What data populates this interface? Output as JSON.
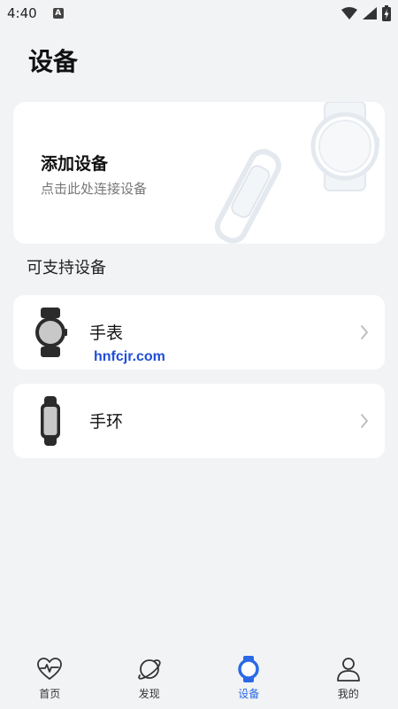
{
  "status_bar": {
    "time": "4:40",
    "notification_icon": "A",
    "icons": [
      "wifi-icon",
      "signal-icon",
      "battery-charging-icon"
    ]
  },
  "page": {
    "title": "设备"
  },
  "add_device_card": {
    "title": "添加设备",
    "subtitle": "点击此处连接设备"
  },
  "supported_section": {
    "title": "可支持设备",
    "items": [
      {
        "label": "手表",
        "icon": "watch-icon"
      },
      {
        "label": "手环",
        "icon": "band-icon"
      }
    ]
  },
  "watermark": "hnfcjr.com",
  "bottom_nav": {
    "active_index": 2,
    "active_color": "#2a6ae8",
    "items": [
      {
        "label": "首页",
        "icon": "heart-pulse-icon"
      },
      {
        "label": "发现",
        "icon": "planet-icon"
      },
      {
        "label": "设备",
        "icon": "watch-icon"
      },
      {
        "label": "我的",
        "icon": "person-icon"
      }
    ]
  }
}
